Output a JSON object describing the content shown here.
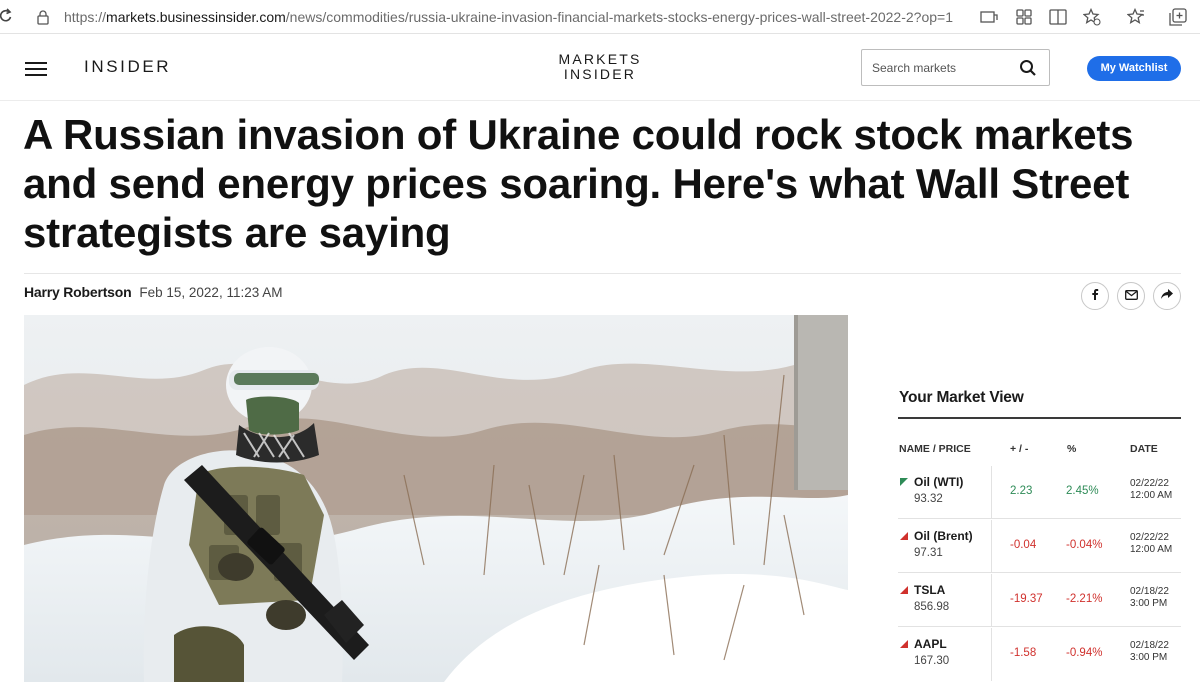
{
  "browser": {
    "url_prefix": "https://",
    "url_host": "markets.businessinsider.com",
    "url_path": "/news/commodities/russia-ukraine-invasion-financial-markets-stocks-energy-prices-wall-street-2022-2?op=1"
  },
  "header": {
    "brand": "INSIDER",
    "logo_line1": "MARKETS",
    "logo_line2": "INSIDER",
    "search_placeholder": "Search markets",
    "watchlist_label": "My Watchlist",
    "accent_color": "#1f6ee8"
  },
  "article": {
    "headline": "A Russian invasion of Ukraine could rock stock markets and send energy prices soaring. Here's what Wall Street strategists are saying",
    "author": "Harry Robertson",
    "date": "Feb 15, 2022, 11:23 AM",
    "share_icons": [
      "facebook-icon",
      "email-icon",
      "share-icon"
    ]
  },
  "market_view": {
    "title": "Your Market View",
    "columns": [
      "NAME / PRICE",
      "+ / -",
      "%",
      "DATE"
    ],
    "rows": [
      {
        "name": "Oil (WTI)",
        "price": "93.32",
        "change": "2.23",
        "percent": "2.45%",
        "date": "02/22/22",
        "time": "12:00 AM",
        "direction": "up"
      },
      {
        "name": "Oil (Brent)",
        "price": "97.31",
        "change": "-0.04",
        "percent": "-0.04%",
        "date": "02/22/22",
        "time": "12:00 AM",
        "direction": "down"
      },
      {
        "name": "TSLA",
        "price": "856.98",
        "change": "-19.37",
        "percent": "-2.21%",
        "date": "02/18/22",
        "time": "3:00 PM",
        "direction": "down"
      },
      {
        "name": "AAPL",
        "price": "167.30",
        "change": "-1.58",
        "percent": "-0.94%",
        "date": "02/18/22",
        "time": "3:00 PM",
        "direction": "down"
      }
    ],
    "up_color": "#2e8b57",
    "down_color": "#d0312d"
  }
}
